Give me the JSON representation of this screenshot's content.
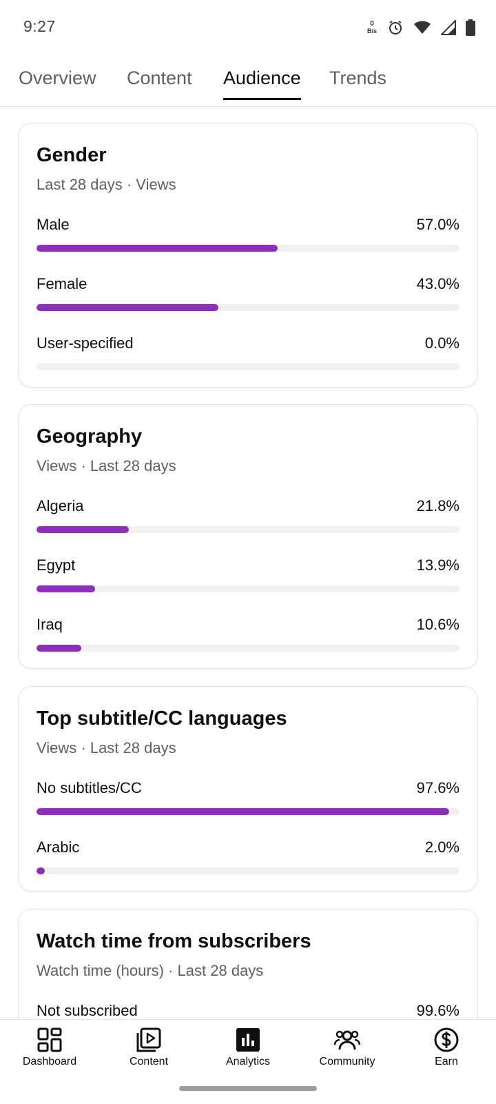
{
  "status_bar": {
    "time": "9:27",
    "net_speed_value": "0",
    "net_speed_unit": "B/s",
    "icons": [
      "alarm-icon",
      "wifi-icon",
      "signal-icon",
      "battery-icon"
    ]
  },
  "tabs": [
    {
      "label": "Overview",
      "active": false
    },
    {
      "label": "Content",
      "active": false
    },
    {
      "label": "Audience",
      "active": true
    },
    {
      "label": "Trends",
      "active": false
    }
  ],
  "accent_color": "#8e2dbf",
  "cards": {
    "gender": {
      "title": "Gender",
      "subtitle": "Last 28 days · Views",
      "rows": [
        {
          "label": "Male",
          "value": "57.0%",
          "percent": 57.0
        },
        {
          "label": "Female",
          "value": "43.0%",
          "percent": 43.0
        },
        {
          "label": "User-specified",
          "value": "0.0%",
          "percent": 0.0
        }
      ]
    },
    "geography": {
      "title": "Geography",
      "subtitle": "Views · Last 28 days",
      "rows": [
        {
          "label": "Algeria",
          "value": "21.8%",
          "percent": 21.8
        },
        {
          "label": "Egypt",
          "value": "13.9%",
          "percent": 13.9
        },
        {
          "label": "Iraq",
          "value": "10.6%",
          "percent": 10.6
        }
      ]
    },
    "subtitles": {
      "title": "Top subtitle/CC languages",
      "subtitle": "Views · Last 28 days",
      "rows": [
        {
          "label": "No subtitles/CC",
          "value": "97.6%",
          "percent": 97.6
        },
        {
          "label": "Arabic",
          "value": "2.0%",
          "percent": 2.0
        }
      ]
    },
    "watch_time": {
      "title": "Watch time from subscribers",
      "subtitle": "Watch time (hours) · Last 28 days",
      "rows": [
        {
          "label": "Not subscribed",
          "value": "99.6%",
          "percent": 99.6
        }
      ]
    }
  },
  "bottom_nav": [
    {
      "label": "Dashboard",
      "icon": "dashboard-icon"
    },
    {
      "label": "Content",
      "icon": "content-icon"
    },
    {
      "label": "Analytics",
      "icon": "analytics-icon",
      "active": true
    },
    {
      "label": "Community",
      "icon": "community-icon"
    },
    {
      "label": "Earn",
      "icon": "earn-icon"
    }
  ]
}
